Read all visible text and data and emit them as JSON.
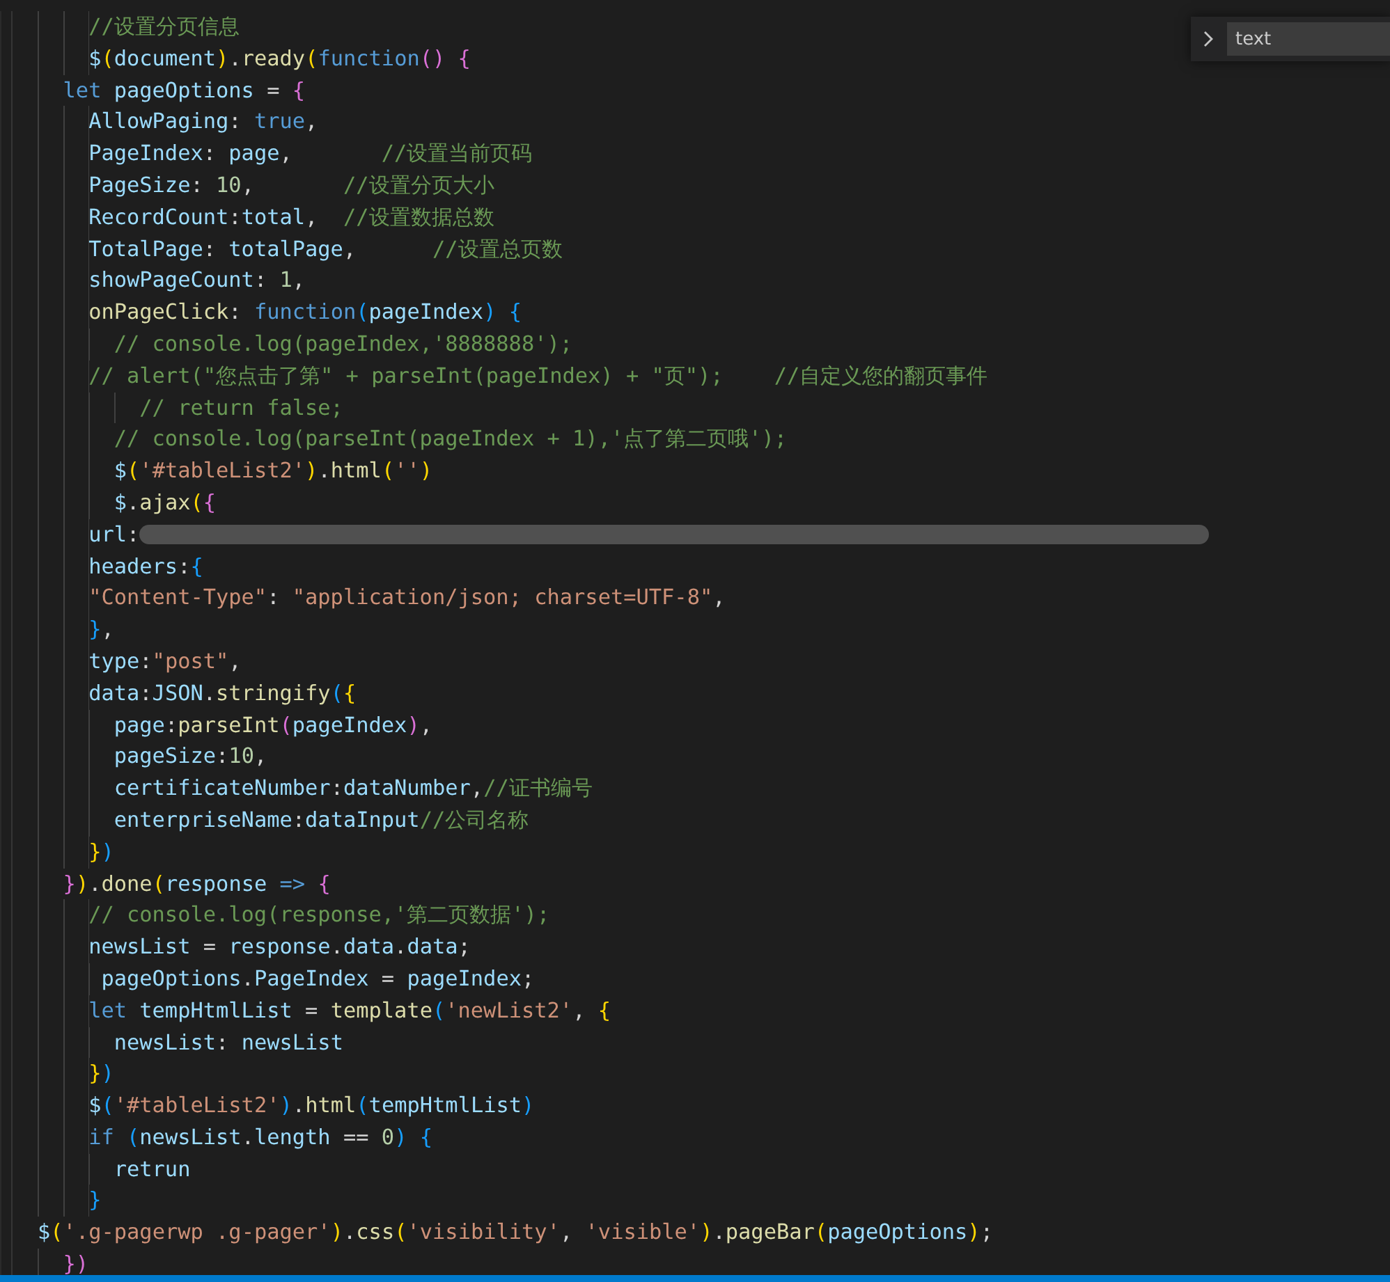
{
  "find_widget": {
    "expanded": false,
    "value": "text"
  },
  "lines": [
    {
      "tokens": [
        {
          "t": "    //设置分页信息",
          "kind": "comment"
        }
      ]
    },
    {
      "tokens": [
        {
          "t": "    $",
          "kind": "variable"
        },
        {
          "t": "(",
          "kind": "bracket1"
        },
        {
          "t": "document",
          "kind": "variable"
        },
        {
          "t": ")",
          "kind": "bracket1"
        },
        {
          "t": ".",
          "kind": "punctuation"
        },
        {
          "t": "ready",
          "kind": "function"
        },
        {
          "t": "(",
          "kind": "bracket1"
        },
        {
          "t": "function",
          "kind": "keyword"
        },
        {
          "t": "() {",
          "kind": "bracket2"
        }
      ]
    },
    {
      "tokens": [
        {
          "t": "  let",
          "kind": "keyword"
        },
        {
          "t": " pageOptions",
          "kind": "variable"
        },
        {
          "t": " = ",
          "kind": "punctuation"
        },
        {
          "t": "{",
          "kind": "bracket2"
        }
      ]
    },
    {
      "tokens": [
        {
          "t": "    AllowPaging",
          "kind": "variable"
        },
        {
          "t": ": ",
          "kind": "punctuation"
        },
        {
          "t": "true",
          "kind": "keyword"
        },
        {
          "t": ",",
          "kind": "punctuation"
        }
      ]
    },
    {
      "tokens": [
        {
          "t": "    PageIndex",
          "kind": "variable"
        },
        {
          "t": ": ",
          "kind": "punctuation"
        },
        {
          "t": "page",
          "kind": "variable"
        },
        {
          "t": ",       ",
          "kind": "punctuation"
        },
        {
          "t": "//设置当前页码",
          "kind": "comment"
        }
      ]
    },
    {
      "tokens": [
        {
          "t": "    PageSize",
          "kind": "variable"
        },
        {
          "t": ": ",
          "kind": "punctuation"
        },
        {
          "t": "10",
          "kind": "number"
        },
        {
          "t": ",       ",
          "kind": "punctuation"
        },
        {
          "t": "//设置分页大小",
          "kind": "comment"
        }
      ]
    },
    {
      "tokens": [
        {
          "t": "    RecordCount",
          "kind": "variable"
        },
        {
          "t": ":",
          "kind": "punctuation"
        },
        {
          "t": "total",
          "kind": "variable"
        },
        {
          "t": ",  ",
          "kind": "punctuation"
        },
        {
          "t": "//设置数据总数",
          "kind": "comment"
        }
      ]
    },
    {
      "tokens": [
        {
          "t": "    TotalPage",
          "kind": "variable"
        },
        {
          "t": ": ",
          "kind": "punctuation"
        },
        {
          "t": "totalPage",
          "kind": "variable"
        },
        {
          "t": ",      ",
          "kind": "punctuation"
        },
        {
          "t": "//设置总页数",
          "kind": "comment"
        }
      ]
    },
    {
      "tokens": [
        {
          "t": "    showPageCount",
          "kind": "variable"
        },
        {
          "t": ": ",
          "kind": "punctuation"
        },
        {
          "t": "1",
          "kind": "number"
        },
        {
          "t": ",",
          "kind": "punctuation"
        }
      ]
    },
    {
      "tokens": [
        {
          "t": "    onPageClick",
          "kind": "function"
        },
        {
          "t": ": ",
          "kind": "punctuation"
        },
        {
          "t": "function",
          "kind": "keyword"
        },
        {
          "t": "(",
          "kind": "bracket3"
        },
        {
          "t": "pageIndex",
          "kind": "variable"
        },
        {
          "t": ") {",
          "kind": "bracket3"
        }
      ]
    },
    {
      "tokens": [
        {
          "t": "      // console.log(pageIndex,'8888888');",
          "kind": "comment"
        }
      ]
    },
    {
      "tokens": [
        {
          "t": "    // alert(\"您点击了第\" + parseInt(pageIndex) + \"页\");    //自定义您的翻页事件",
          "kind": "comment"
        }
      ]
    },
    {
      "tokens": [
        {
          "t": "        // return false;",
          "kind": "comment"
        }
      ]
    },
    {
      "tokens": [
        {
          "t": "      // console.log(parseInt(pageIndex + 1),'点了第二页哦');",
          "kind": "comment"
        }
      ]
    },
    {
      "tokens": [
        {
          "t": "      $",
          "kind": "variable"
        },
        {
          "t": "(",
          "kind": "bracket1"
        },
        {
          "t": "'#tableList2'",
          "kind": "string"
        },
        {
          "t": ")",
          "kind": "bracket1"
        },
        {
          "t": ".",
          "kind": "punctuation"
        },
        {
          "t": "html",
          "kind": "function"
        },
        {
          "t": "(",
          "kind": "bracket1"
        },
        {
          "t": "''",
          "kind": "string"
        },
        {
          "t": ")",
          "kind": "bracket1"
        }
      ]
    },
    {
      "tokens": [
        {
          "t": "      $",
          "kind": "variable"
        },
        {
          "t": ".",
          "kind": "punctuation"
        },
        {
          "t": "ajax",
          "kind": "function"
        },
        {
          "t": "(",
          "kind": "bracket1"
        },
        {
          "t": "{",
          "kind": "bracket2"
        }
      ]
    },
    {
      "tokens": [
        {
          "t": "    url",
          "kind": "variable"
        },
        {
          "t": ":",
          "kind": "punctuation"
        },
        {
          "kind": "redacted"
        }
      ]
    },
    {
      "tokens": [
        {
          "t": "    headers",
          "kind": "variable"
        },
        {
          "t": ":",
          "kind": "punctuation"
        },
        {
          "t": "{",
          "kind": "bracket3"
        }
      ]
    },
    {
      "tokens": [
        {
          "t": "    \"Content-Type\"",
          "kind": "string"
        },
        {
          "t": ": ",
          "kind": "punctuation"
        },
        {
          "t": "\"application/json; charset=UTF-8\"",
          "kind": "string"
        },
        {
          "t": ",",
          "kind": "punctuation"
        }
      ]
    },
    {
      "tokens": [
        {
          "t": "    }",
          "kind": "bracket3"
        },
        {
          "t": ",",
          "kind": "punctuation"
        }
      ]
    },
    {
      "tokens": [
        {
          "t": "    type",
          "kind": "variable"
        },
        {
          "t": ":",
          "kind": "punctuation"
        },
        {
          "t": "\"post\"",
          "kind": "string"
        },
        {
          "t": ",",
          "kind": "punctuation"
        }
      ]
    },
    {
      "tokens": [
        {
          "t": "    data",
          "kind": "variable"
        },
        {
          "t": ":",
          "kind": "punctuation"
        },
        {
          "t": "JSON",
          "kind": "variable"
        },
        {
          "t": ".",
          "kind": "punctuation"
        },
        {
          "t": "stringify",
          "kind": "function"
        },
        {
          "t": "(",
          "kind": "bracket3"
        },
        {
          "t": "{",
          "kind": "bracket1"
        }
      ]
    },
    {
      "tokens": [
        {
          "t": "      page",
          "kind": "variable"
        },
        {
          "t": ":",
          "kind": "punctuation"
        },
        {
          "t": "parseInt",
          "kind": "function"
        },
        {
          "t": "(",
          "kind": "bracket2"
        },
        {
          "t": "pageIndex",
          "kind": "variable"
        },
        {
          "t": ")",
          "kind": "bracket2"
        },
        {
          "t": ",",
          "kind": "punctuation"
        }
      ]
    },
    {
      "tokens": [
        {
          "t": "      pageSize",
          "kind": "variable"
        },
        {
          "t": ":",
          "kind": "punctuation"
        },
        {
          "t": "10",
          "kind": "number"
        },
        {
          "t": ",",
          "kind": "punctuation"
        }
      ]
    },
    {
      "tokens": [
        {
          "t": "      certificateNumber",
          "kind": "variable"
        },
        {
          "t": ":",
          "kind": "punctuation"
        },
        {
          "t": "dataNumber",
          "kind": "variable"
        },
        {
          "t": ",",
          "kind": "punctuation"
        },
        {
          "t": "//证书编号",
          "kind": "comment"
        }
      ]
    },
    {
      "tokens": [
        {
          "t": "      enterpriseName",
          "kind": "variable"
        },
        {
          "t": ":",
          "kind": "punctuation"
        },
        {
          "t": "dataInput",
          "kind": "variable"
        },
        {
          "t": "//公司名称",
          "kind": "comment"
        }
      ]
    },
    {
      "tokens": [
        {
          "t": "    }",
          "kind": "bracket1"
        },
        {
          "t": ")",
          "kind": "bracket3"
        }
      ]
    },
    {
      "tokens": [
        {
          "t": "  }",
          "kind": "bracket2"
        },
        {
          "t": ")",
          "kind": "bracket1"
        },
        {
          "t": ".",
          "kind": "punctuation"
        },
        {
          "t": "done",
          "kind": "function"
        },
        {
          "t": "(",
          "kind": "bracket1"
        },
        {
          "t": "response",
          "kind": "variable"
        },
        {
          "t": " => ",
          "kind": "keyword"
        },
        {
          "t": "{",
          "kind": "bracket2"
        }
      ]
    },
    {
      "tokens": [
        {
          "t": "    // console.log(response,'第二页数据');",
          "kind": "comment"
        }
      ]
    },
    {
      "tokens": [
        {
          "t": "    newsList",
          "kind": "variable"
        },
        {
          "t": " = ",
          "kind": "punctuation"
        },
        {
          "t": "response",
          "kind": "variable"
        },
        {
          "t": ".",
          "kind": "punctuation"
        },
        {
          "t": "data",
          "kind": "variable"
        },
        {
          "t": ".",
          "kind": "punctuation"
        },
        {
          "t": "data",
          "kind": "variable"
        },
        {
          "t": ";",
          "kind": "punctuation"
        }
      ]
    },
    {
      "tokens": [
        {
          "t": "     pageOptions",
          "kind": "variable"
        },
        {
          "t": ".",
          "kind": "punctuation"
        },
        {
          "t": "PageIndex",
          "kind": "variable"
        },
        {
          "t": " = ",
          "kind": "punctuation"
        },
        {
          "t": "pageIndex",
          "kind": "variable"
        },
        {
          "t": ";",
          "kind": "punctuation"
        }
      ]
    },
    {
      "tokens": [
        {
          "t": "    let",
          "kind": "keyword"
        },
        {
          "t": " tempHtmlList",
          "kind": "variable"
        },
        {
          "t": " = ",
          "kind": "punctuation"
        },
        {
          "t": "template",
          "kind": "function"
        },
        {
          "t": "(",
          "kind": "bracket3"
        },
        {
          "t": "'newList2'",
          "kind": "string"
        },
        {
          "t": ", ",
          "kind": "punctuation"
        },
        {
          "t": "{",
          "kind": "bracket1"
        }
      ]
    },
    {
      "tokens": [
        {
          "t": "      newsList",
          "kind": "variable"
        },
        {
          "t": ": ",
          "kind": "punctuation"
        },
        {
          "t": "newsList",
          "kind": "variable"
        }
      ]
    },
    {
      "tokens": [
        {
          "t": "    }",
          "kind": "bracket1"
        },
        {
          "t": ")",
          "kind": "bracket3"
        }
      ]
    },
    {
      "tokens": [
        {
          "t": "    $",
          "kind": "variable"
        },
        {
          "t": "(",
          "kind": "bracket3"
        },
        {
          "t": "'#tableList2'",
          "kind": "string"
        },
        {
          "t": ")",
          "kind": "bracket3"
        },
        {
          "t": ".",
          "kind": "punctuation"
        },
        {
          "t": "html",
          "kind": "function"
        },
        {
          "t": "(",
          "kind": "bracket3"
        },
        {
          "t": "tempHtmlList",
          "kind": "variable"
        },
        {
          "t": ")",
          "kind": "bracket3"
        }
      ]
    },
    {
      "tokens": [
        {
          "t": "    if ",
          "kind": "keyword"
        },
        {
          "t": "(",
          "kind": "bracket3"
        },
        {
          "t": "newsList",
          "kind": "variable"
        },
        {
          "t": ".",
          "kind": "punctuation"
        },
        {
          "t": "length",
          "kind": "variable"
        },
        {
          "t": " == ",
          "kind": "punctuation"
        },
        {
          "t": "0",
          "kind": "number"
        },
        {
          "t": ") {",
          "kind": "bracket3"
        }
      ]
    },
    {
      "tokens": [
        {
          "t": "      retrun",
          "kind": "variable"
        }
      ]
    },
    {
      "tokens": [
        {
          "t": "    }",
          "kind": "bracket3"
        }
      ]
    },
    {
      "tokens": [
        {
          "t": "$",
          "kind": "variable"
        },
        {
          "t": "(",
          "kind": "bracket1"
        },
        {
          "t": "'.g-pagerwp .g-pager'",
          "kind": "string"
        },
        {
          "t": ")",
          "kind": "bracket1"
        },
        {
          "t": ".",
          "kind": "punctuation"
        },
        {
          "t": "css",
          "kind": "function"
        },
        {
          "t": "(",
          "kind": "bracket1"
        },
        {
          "t": "'visibility'",
          "kind": "string"
        },
        {
          "t": ", ",
          "kind": "punctuation"
        },
        {
          "t": "'visible'",
          "kind": "string"
        },
        {
          "t": ")",
          "kind": "bracket1"
        },
        {
          "t": ".",
          "kind": "punctuation"
        },
        {
          "t": "pageBar",
          "kind": "function"
        },
        {
          "t": "(",
          "kind": "bracket1"
        },
        {
          "t": "pageOptions",
          "kind": "variable"
        },
        {
          "t": ")",
          "kind": "bracket1"
        },
        {
          "t": ";",
          "kind": "punctuation"
        }
      ]
    },
    {
      "tokens": [
        {
          "t": "  })",
          "kind": "bracket2"
        }
      ]
    }
  ]
}
